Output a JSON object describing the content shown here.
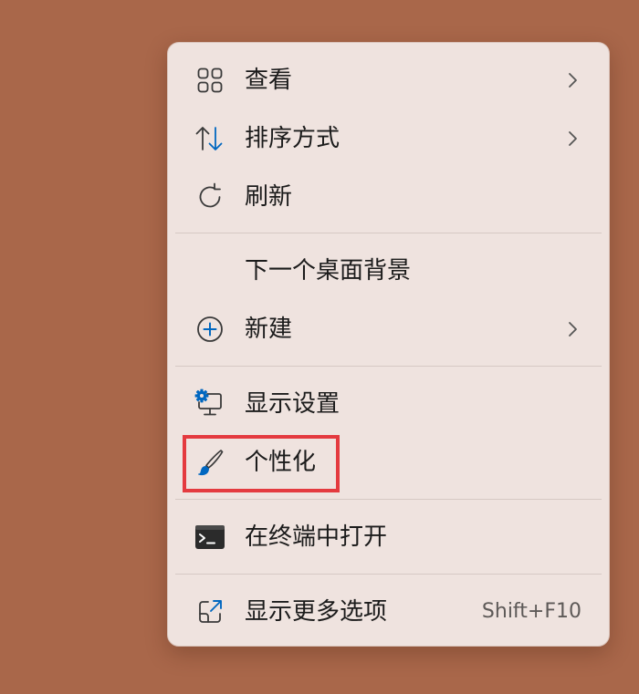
{
  "menu": {
    "items": [
      {
        "id": "view",
        "label": "查看",
        "icon": "grid-view-icon",
        "has_submenu": true
      },
      {
        "id": "sort",
        "label": "排序方式",
        "icon": "sort-arrows-icon",
        "has_submenu": true
      },
      {
        "id": "refresh",
        "label": "刷新",
        "icon": "refresh-icon",
        "has_submenu": false
      },
      {
        "id": "next-bg",
        "label": "下一个桌面背景",
        "icon": "",
        "has_submenu": false
      },
      {
        "id": "new",
        "label": "新建",
        "icon": "plus-circle-icon",
        "has_submenu": true
      },
      {
        "id": "display",
        "label": "显示设置",
        "icon": "display-settings-icon",
        "has_submenu": false
      },
      {
        "id": "personalize",
        "label": "个性化",
        "icon": "brush-icon",
        "has_submenu": false,
        "highlighted": true
      },
      {
        "id": "terminal",
        "label": "在终端中打开",
        "icon": "terminal-icon",
        "has_submenu": false
      },
      {
        "id": "more",
        "label": "显示更多选项",
        "icon": "open-external-icon",
        "has_submenu": false,
        "shortcut": "Shift+F10"
      }
    ]
  },
  "colors": {
    "desktop_background": "#A9674A",
    "menu_background": "#EFE3DF",
    "accent_blue": "#0067C0",
    "highlight_box": "#E43A3F"
  }
}
